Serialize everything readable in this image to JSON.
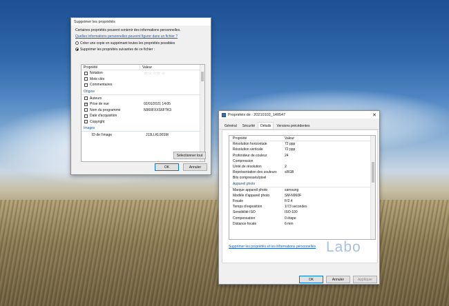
{
  "dialog1": {
    "title": "Supprimer les propriétés",
    "intro": "Certaines propriétés peuvent contenir des informations personnelles.",
    "link": "Quelles informations personnelles peuvent figurer dans un fichier ?",
    "option_copy": "Créer une copie en supprimant toutes les propriétés possibles",
    "option_remove": "Supprimer les propriétés suivantes de ce fichier :",
    "col_property": "Propriété",
    "col_value": "Valeur",
    "rows_top": [
      {
        "name": "Notation",
        "value": "☆☆☆☆☆",
        "checked": false
      },
      {
        "name": "Mots clés",
        "value": "",
        "checked": false
      },
      {
        "name": "Commentaires",
        "value": "",
        "checked": false
      }
    ],
    "group_origin": "Origine",
    "rows_origin": [
      {
        "name": "Auteurs",
        "value": "",
        "checked": false
      },
      {
        "name": "Prise de vue",
        "value": "02/01/2021 14:05",
        "checked": true
      },
      {
        "name": "Nom du programme",
        "value": "N960FXXS6FTK3",
        "checked": false
      },
      {
        "name": "Date d'acquisition",
        "value": "",
        "checked": false
      },
      {
        "name": "Copyright",
        "value": "",
        "checked": false
      }
    ],
    "group_images": "Images",
    "rows_images": [
      {
        "name": "ID de l'image",
        "value": "J13LLKL00SM"
      }
    ],
    "select_all": "Sélectionner tout",
    "ok": "OK",
    "cancel": "Annuler"
  },
  "dialog2": {
    "title": "Propriétés de : 20210102_140547",
    "tabs": [
      "Général",
      "Sécurité",
      "Détails",
      "Versions précédentes"
    ],
    "col_property": "Propriété",
    "col_value": "Valeur",
    "rows_image": [
      {
        "k": "Résolution horizontale",
        "v": "72 ppp"
      },
      {
        "k": "Résolution verticale",
        "v": "72 ppp"
      },
      {
        "k": "Profondeur de couleur",
        "v": "24"
      },
      {
        "k": "Compression",
        "v": ""
      },
      {
        "k": "Unité de résolution",
        "v": "2"
      },
      {
        "k": "Représentation des couleurs",
        "v": "sRGB"
      },
      {
        "k": "Bits compressés/pixel",
        "v": ""
      }
    ],
    "group_camera": "Appareil photo",
    "rows_camera": [
      {
        "k": "Marque appareil photo",
        "v": "samsung"
      },
      {
        "k": "Modèle d'appareil photo",
        "v": "SM-N960F"
      },
      {
        "k": "Focale",
        "v": "F/2.4"
      },
      {
        "k": "Temps d'exposition",
        "v": "1/73 secondes"
      },
      {
        "k": "Sensibilité ISO",
        "v": "ISO-100"
      },
      {
        "k": "Compensation",
        "v": "0 étape"
      },
      {
        "k": "Distance focale",
        "v": "6 mm"
      }
    ],
    "remove_link": "Supprimer les propriétés et les informations personnelles",
    "ok": "OK",
    "cancel": "Annuler",
    "apply": "Appliquer"
  },
  "watermark": "Labo"
}
